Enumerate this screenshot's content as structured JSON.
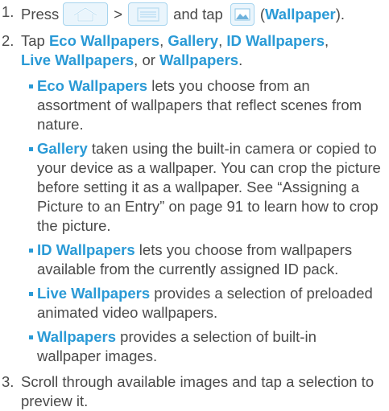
{
  "steps": [
    {
      "number": "1.",
      "press": "Press",
      "gt": ">",
      "and_tap": "and tap",
      "close": "(",
      "wallpaper_label": "Wallpaper",
      "close_end": ")."
    },
    {
      "number": "2.",
      "tap": "Tap",
      "opt_eco": "Eco Wallpapers",
      "c1": ",",
      "opt_gallery": "Gallery",
      "c2": ",",
      "opt_id": "ID Wallpapers",
      "c3": ",",
      "opt_live": "Live Wallpapers",
      "or": ", or",
      "opt_wall": "Wallpapers",
      "end": "."
    },
    {
      "number": "3.",
      "text": "Scroll through available images and tap a selection to preview it."
    }
  ],
  "bullets": [
    {
      "term": "Eco Wallpapers",
      "text": " lets you choose from an assortment of wallpapers that reflect scenes from nature."
    },
    {
      "term": "Gallery",
      "text": " taken using the built-in camera or copied to your device as a wallpaper. You can crop the picture before setting it as a wallpaper. See “Assigning a Picture to an Entry” on page 91 to learn how to crop the picture."
    },
    {
      "term": "ID Wallpapers",
      "text": " lets you choose from wallpapers available from the currently assigned ID pack."
    },
    {
      "term": "Live Wallpapers",
      "text": " provides a selection of preloaded animated video wallpapers."
    },
    {
      "term": "Wallpapers",
      "text": " provides a selection of built-in wallpaper images."
    }
  ],
  "icons": {
    "home": "home-icon",
    "menu": "menu-icon",
    "wallpaper": "wallpaper-icon"
  },
  "colors": {
    "highlight": "#2a9ad6",
    "body_text": "#4a4a4a",
    "icon_border": "#a6d4ee",
    "icon_fill": "#eaf5fc"
  }
}
